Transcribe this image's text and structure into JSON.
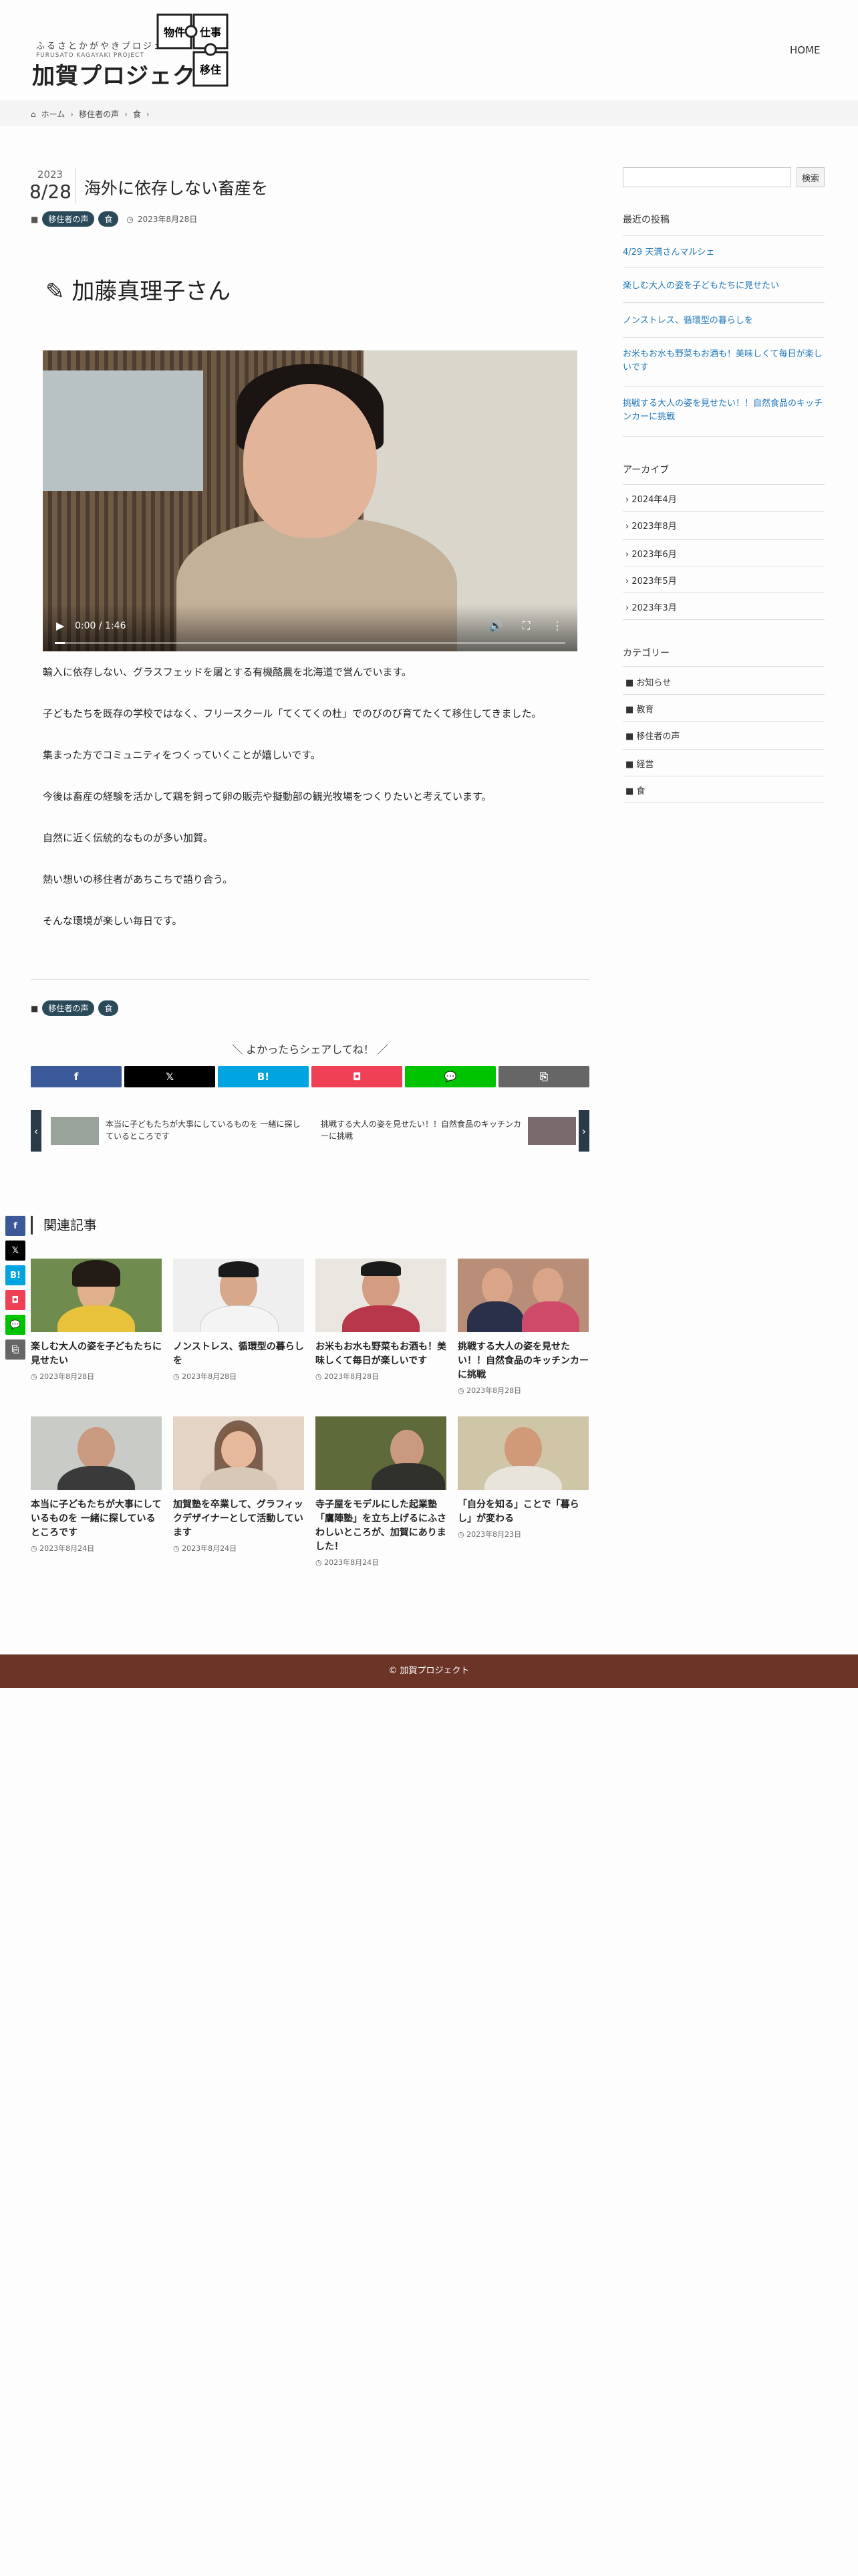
{
  "header": {
    "logo_small": "ふるさとかがやきプロジェクト",
    "logo_small2": "FURUSATO KAGAYAKI PROJECT",
    "logo_main": "加賀プロジェクト",
    "logo_badges": [
      "物件",
      "仕事",
      "移住"
    ],
    "nav_home": "HOME"
  },
  "breadcrumb": {
    "items": [
      "ホーム",
      "移住者の声",
      "食"
    ]
  },
  "article": {
    "year": "2023",
    "month_day": "8/28",
    "title": "海外に依存しない畜産を",
    "tags": [
      "移住者の声",
      "食"
    ],
    "date": "2023年8月28日",
    "person": "加藤真理子さん",
    "video_time": "0:00 / 1:46",
    "video_progress": 0.02,
    "paragraphs": [
      "輸入に依存しない、グラスフェッドを屠とする有機酪農を北海道で営んでいます。",
      "子どもたちを既存の学校ではなく、フリースクール「てくてくの杜」でのびのび育てたくて移住してきました。",
      "集まった方でコミュニティをつくっていくことが嬉しいです。",
      "今後は畜産の経験を活かして鶏を飼って卵の販売や擬動部の観光牧場をつくりたいと考えています。",
      "自然に近く伝統的なものが多い加賀。",
      "熱い想いの移住者があちこちで語り合う。",
      "そんな環境が楽しい毎日です。"
    ],
    "bottom_tags": [
      "移住者の声",
      "食"
    ]
  },
  "share": {
    "title": "＼ よかったらシェアしてね！ ／",
    "buttons": [
      {
        "label": "f",
        "color": "#3b5998"
      },
      {
        "label": "𝕏",
        "color": "#000000"
      },
      {
        "label": "B!",
        "color": "#00a4de"
      },
      {
        "label": "◘",
        "color": "#ef4056"
      },
      {
        "label": "💬",
        "color": "#00c300"
      },
      {
        "label": "⎘",
        "color": "#666666"
      }
    ]
  },
  "prevnext": {
    "prev_text": "本当に子どもたちが大事にしているものを 一緒に探しているところです",
    "next_text": "挑戦する大人の姿を見せたい！！自然食品のキッチンカーに挑戦"
  },
  "related": {
    "title": "関連記事",
    "cards": [
      {
        "title": "楽しむ大人の姿を子どもたちに見せたい",
        "date": "2023年8月28日"
      },
      {
        "title": "ノンストレス、循環型の暮らしを",
        "date": "2023年8月28日"
      },
      {
        "title": "お米もお水も野菜もお酒も！美味しくて毎日が楽しいです",
        "date": "2023年8月28日"
      },
      {
        "title": "挑戦する大人の姿を見せたい！！自然食品のキッチンカーに挑戦",
        "date": "2023年8月28日"
      },
      {
        "title": "本当に子どもたちが大事にしているものを 一緒に探しているところです",
        "date": "2023年8月24日"
      },
      {
        "title": "加賀塾を卒業して、グラフィックデザイナーとして活動しています",
        "date": "2023年8月24日"
      },
      {
        "title": "寺子屋をモデルにした起業塾「鷹陣塾」を立ち上げるにふさわしいところが、加賀にありました！",
        "date": "2023年8月24日"
      },
      {
        "title": "「自分を知る」ことで「暮らし」が変わる",
        "date": "2023年8月23日"
      }
    ]
  },
  "sidebar": {
    "search_button": "検索",
    "recent_title": "最近の投稿",
    "recent": [
      "4/29 天満さんマルシェ",
      "楽しむ大人の姿を子どもたちに見せたい",
      "ノンストレス、循環型の暮らしを",
      "お米もお水も野菜もお酒も！美味しくて毎日が楽しいです",
      "挑戦する大人の姿を見せたい！！自然食品のキッチンカーに挑戦"
    ],
    "archive_title": "アーカイブ",
    "archives": [
      "2024年4月",
      "2023年8月",
      "2023年6月",
      "2023年5月",
      "2023年3月"
    ],
    "category_title": "カテゴリー",
    "categories": [
      "お知らせ",
      "教育",
      "移住者の声",
      "経営",
      "食"
    ]
  },
  "footer": {
    "text": "© 加賀プロジェクト"
  }
}
